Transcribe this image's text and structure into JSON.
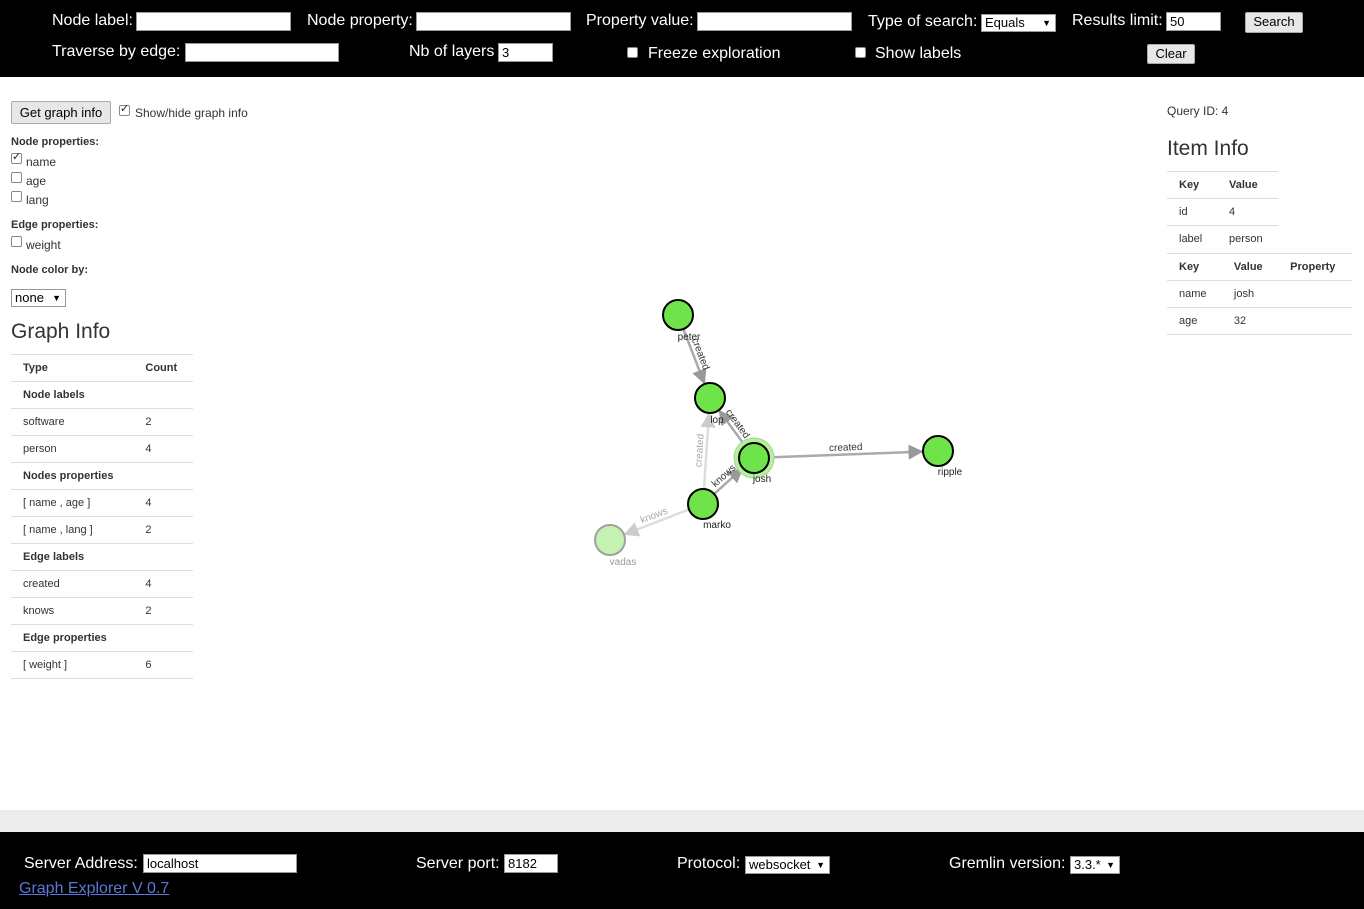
{
  "search_bar": {
    "node_label": "Node label:",
    "node_property": "Node property:",
    "property_value": "Property value:",
    "type_of_search": "Type of search:",
    "type_of_search_value": "Equals",
    "results_limit": "Results limit:",
    "results_limit_value": "50",
    "search_button": "Search",
    "traverse_by_edge": "Traverse by edge:",
    "nb_of_layers": "Nb of layers",
    "nb_of_layers_value": "3",
    "freeze_exploration": "Freeze exploration",
    "show_labels": "Show labels",
    "clear_button": "Clear"
  },
  "left_panel": {
    "get_graph_info_button": "Get graph info",
    "show_hide_graph_info": "Show/hide graph info",
    "node_properties_title": "Node properties:",
    "node_properties": [
      {
        "label": "name",
        "checked": true
      },
      {
        "label": "age",
        "checked": false
      },
      {
        "label": "lang",
        "checked": false
      }
    ],
    "edge_properties_title": "Edge properties:",
    "edge_properties": [
      {
        "label": "weight",
        "checked": false
      }
    ],
    "node_color_by_title": "Node color by:",
    "node_color_by_value": "none",
    "graph_info_title": "Graph Info",
    "graph_info_headers": [
      "Type",
      "Count"
    ],
    "graph_info_rows": [
      {
        "type": "Node labels",
        "count": "",
        "section": true
      },
      {
        "type": "software",
        "count": "2"
      },
      {
        "type": "person",
        "count": "4"
      },
      {
        "type": "Nodes properties",
        "count": "",
        "section": true
      },
      {
        "type": "[ name , age ]",
        "count": "4"
      },
      {
        "type": "[ name , lang ]",
        "count": "2"
      },
      {
        "type": "Edge labels",
        "count": "",
        "section": true
      },
      {
        "type": "created",
        "count": "4"
      },
      {
        "type": "knows",
        "count": "2"
      },
      {
        "type": "Edge properties",
        "count": "",
        "section": true
      },
      {
        "type": "[ weight ]",
        "count": "6"
      }
    ]
  },
  "right_panel": {
    "query_id": "Query ID: 4",
    "item_info_title": "Item Info",
    "item_headers": [
      "Key",
      "Value"
    ],
    "item_rows": [
      {
        "key": "id",
        "value": "4"
      },
      {
        "key": "label",
        "value": "person"
      }
    ],
    "prop_headers": [
      "Key",
      "Value",
      "Property"
    ],
    "prop_rows": [
      {
        "key": "name",
        "value": "josh",
        "property": ""
      },
      {
        "key": "age",
        "value": "32",
        "property": ""
      }
    ]
  },
  "graph": {
    "nodes": [
      {
        "id": "peter",
        "label": "peter",
        "faded": false
      },
      {
        "id": "lop",
        "label": "lop",
        "faded": false
      },
      {
        "id": "josh",
        "label": "josh",
        "faded": false,
        "selected": true
      },
      {
        "id": "ripple",
        "label": "ripple",
        "faded": false
      },
      {
        "id": "marko",
        "label": "marko",
        "faded": false
      },
      {
        "id": "vadas",
        "label": "vadas",
        "faded": true
      }
    ],
    "edges": [
      {
        "source": "peter",
        "target": "lop",
        "label": "created",
        "faded": false
      },
      {
        "source": "josh",
        "target": "lop",
        "label": "created",
        "faded": false
      },
      {
        "source": "marko",
        "target": "lop",
        "label": "created",
        "faded": true
      },
      {
        "source": "josh",
        "target": "ripple",
        "label": "created",
        "faded": false
      },
      {
        "source": "marko",
        "target": "josh",
        "label": "knows",
        "faded": false
      },
      {
        "source": "marko",
        "target": "vadas",
        "label": "knows",
        "faded": true
      }
    ],
    "node_color": "#6fe34a",
    "node_faded_color": "#b7ef9e"
  },
  "footer": {
    "server_address_label": "Server Address:",
    "server_address_value": "localhost",
    "server_port_label": "Server port:",
    "server_port_value": "8182",
    "protocol_label": "Protocol:",
    "protocol_value": "websocket",
    "gremlin_version_label": "Gremlin version:",
    "gremlin_version_value": "3.3.*",
    "version_link": "Graph Explorer V 0.7"
  }
}
